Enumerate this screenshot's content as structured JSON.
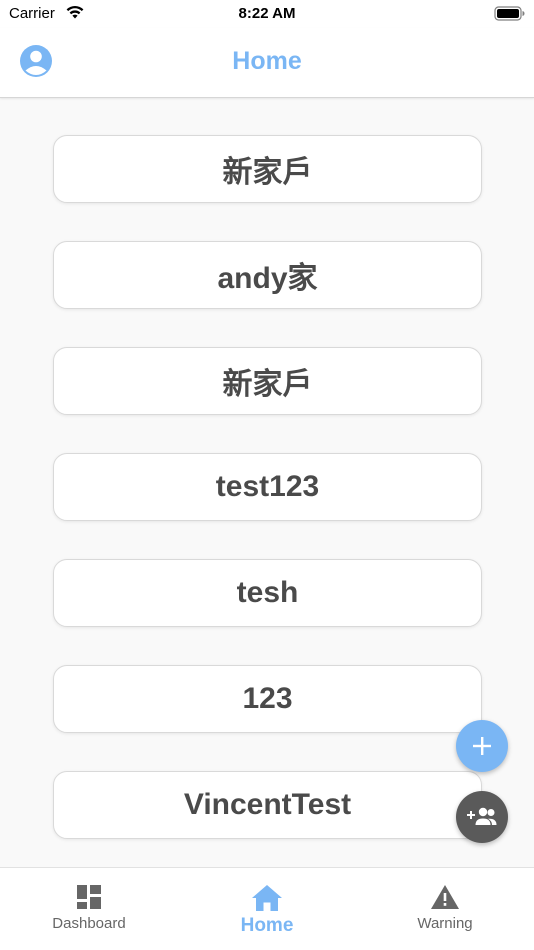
{
  "status_bar": {
    "carrier": "Carrier",
    "time": "8:22 AM"
  },
  "header": {
    "title": "Home",
    "accent_color": "#7ab6f4"
  },
  "homes": [
    {
      "name": "新家戶"
    },
    {
      "name": "andy家"
    },
    {
      "name": "新家戶"
    },
    {
      "name": "test123"
    },
    {
      "name": "tesh"
    },
    {
      "name": "123"
    },
    {
      "name": "VincentTest"
    }
  ],
  "fabs": {
    "add_icon": "plus-icon",
    "group_icon": "add-group-icon"
  },
  "tab_bar": {
    "tabs": [
      {
        "label": "Dashboard",
        "icon": "dashboard-icon",
        "active": false
      },
      {
        "label": "Home",
        "icon": "home-icon",
        "active": true
      },
      {
        "label": "Warning",
        "icon": "warning-icon",
        "active": false
      }
    ]
  },
  "colors": {
    "accent": "#7ab6f4",
    "card_text": "#4a4a4a",
    "fab_dark": "#5a5a5a"
  }
}
